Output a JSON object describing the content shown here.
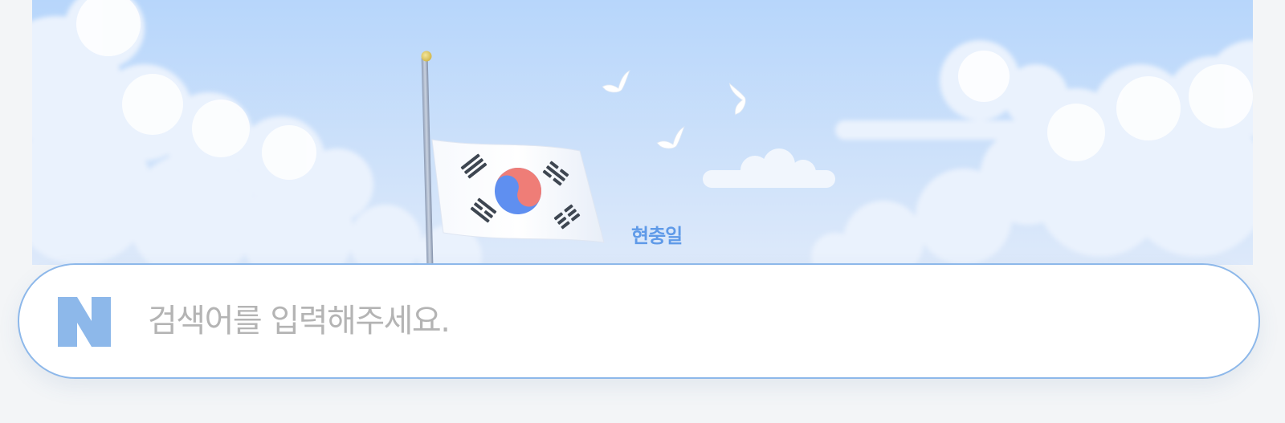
{
  "doodle": {
    "caption": "현충일",
    "colors": {
      "sky_top": "#b7d6fb",
      "sky_bottom": "#dbe9fb",
      "caption": "#5f9ae8",
      "flag_red": "#ef7d77",
      "flag_blue": "#5f8ff0",
      "trigram": "#3e4651"
    }
  },
  "search": {
    "placeholder": "검색어를 입력해주세요.",
    "value": "",
    "border_color": "#8db8ea"
  },
  "logo": {
    "letter": "N",
    "color": "#8db8ea"
  }
}
